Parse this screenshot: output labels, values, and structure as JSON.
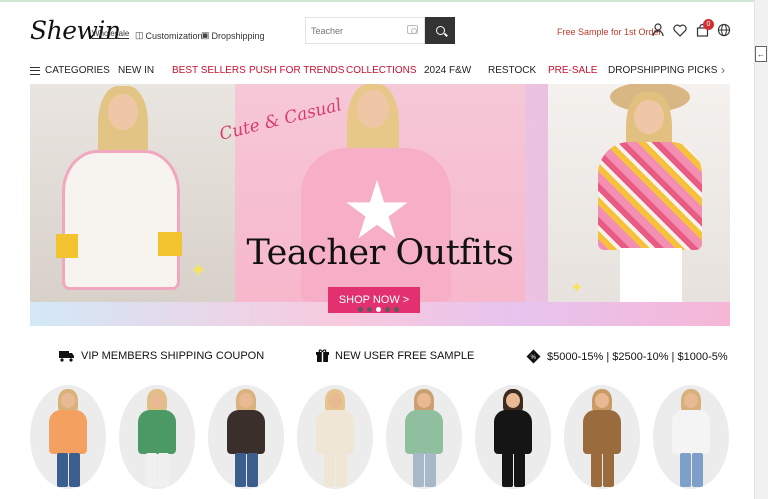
{
  "header": {
    "logo": "Shewin",
    "logo_sub": "Wholesale",
    "links": [
      {
        "label": "Customization",
        "icon": "tshirt-icon"
      },
      {
        "label": "Dropshipping",
        "icon": "box-icon"
      }
    ],
    "search": {
      "placeholder": "Teacher"
    },
    "free_sample": "Free Sample for 1st Order",
    "cart_count": "0"
  },
  "nav": {
    "categories_label": "CATEGORIES",
    "items": [
      {
        "label": "NEW IN",
        "highlight": false
      },
      {
        "label": "BEST SELLERS",
        "highlight": true
      },
      {
        "label": "PUSH FOR TRENDS",
        "highlight": true
      },
      {
        "label": "COLLECTIONS",
        "highlight": true
      },
      {
        "label": "2024 F&W",
        "highlight": false
      },
      {
        "label": "RESTOCK",
        "highlight": false
      },
      {
        "label": "PRE-SALE",
        "highlight": true
      },
      {
        "label": "DROPSHIPPING PICKS",
        "highlight": false
      }
    ],
    "prev_arrow": "‹",
    "next_arrow": "›"
  },
  "banner": {
    "script_text": "Cute & Casual",
    "title": "Teacher Outfits",
    "button": "SHOP NOW >",
    "slide_count": 5,
    "active_slide": 2
  },
  "promos": [
    {
      "label": "VIP MEMBERS SHIPPING COUPON",
      "icon": "truck-icon"
    },
    {
      "label": "NEW USER FREE SAMPLE",
      "icon": "gift-icon"
    },
    {
      "label": "$5000-15% | $2500-10% | $1000-5%",
      "icon": "discount-tag-icon"
    }
  ],
  "colors": {
    "accent_red": "#c8102e",
    "shop_button": "#e2316e",
    "search_button": "#333333"
  },
  "products": [
    {
      "top": "#f3a060",
      "hair": "#d9b27a",
      "legs": "#3a5f8f"
    },
    {
      "top": "#4b9a66",
      "hair": "#e0c086",
      "legs": "#f0f0f0"
    },
    {
      "top": "#3a2f2b",
      "hair": "#d8b37e",
      "legs": "#3c5e8c"
    },
    {
      "top": "#efe6d6",
      "hair": "#e6c58d",
      "legs": "#efe6d6"
    },
    {
      "top": "#8fbf9e",
      "hair": "#caa070",
      "legs": "#a7b8c9"
    },
    {
      "top": "#151515",
      "hair": "#3a2a20",
      "legs": "#151515"
    },
    {
      "top": "#9a6b3d",
      "hair": "#c99c66",
      "legs": "#9a6b3d"
    },
    {
      "top": "#f4f4f4",
      "hair": "#d7b07a",
      "legs": "#7ea0c8"
    }
  ]
}
